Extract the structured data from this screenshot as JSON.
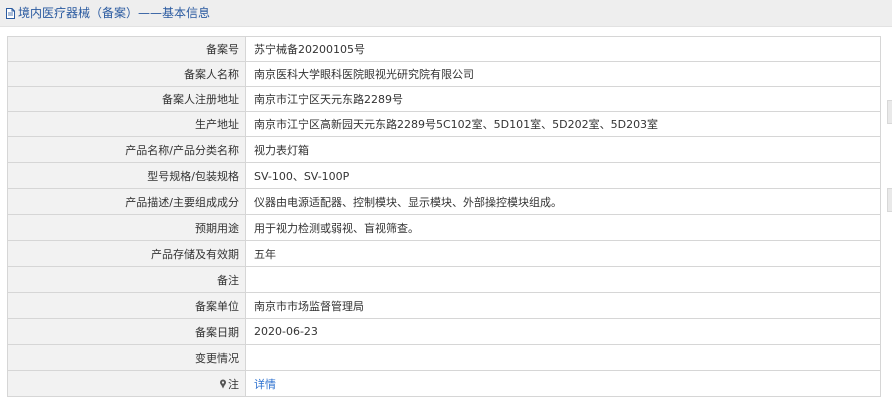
{
  "header": {
    "title": "境内医疗器械（备案）——基本信息",
    "icon": "document-icon"
  },
  "rows": [
    {
      "label": "备案号",
      "value": "苏宁械备20200105号"
    },
    {
      "label": "备案人名称",
      "value": "南京医科大学眼科医院眼视光研究院有限公司"
    },
    {
      "label": "备案人注册地址",
      "value": "南京市江宁区天元东路2289号"
    },
    {
      "label": "生产地址",
      "value": "南京市江宁区高新园天元东路2289号5C102室、5D101室、5D202室、5D203室"
    },
    {
      "label": "产品名称/产品分类名称",
      "value": "视力表灯箱"
    },
    {
      "label": "型号规格/包装规格",
      "value": "SV-100、SV-100P"
    },
    {
      "label": "产品描述/主要组成成分",
      "value": "仪器由电源适配器、控制模块、显示模块、外部操控模块组成。"
    },
    {
      "label": "预期用途",
      "value": "用于视力检测或弱视、盲视筛查。"
    },
    {
      "label": "产品存储及有效期",
      "value": "五年"
    },
    {
      "label": "备注",
      "value": ""
    },
    {
      "label": "备案单位",
      "value": "南京市市场监督管理局"
    },
    {
      "label": "备案日期",
      "value": "2020-06-23"
    },
    {
      "label": "变更情况",
      "value": ""
    }
  ],
  "note_row": {
    "label": "注",
    "icon": "pin-icon",
    "link_text": "详情"
  },
  "colors": {
    "header_bg": "#eeeeee",
    "title_blue": "#2a5aa0",
    "label_bg": "#f2f2f2",
    "border": "#d6d6d6",
    "link": "#2a6fcf"
  }
}
